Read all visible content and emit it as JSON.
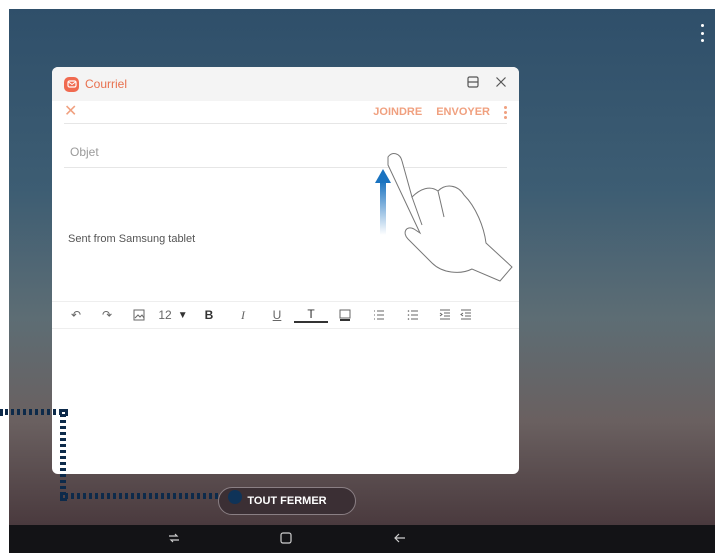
{
  "app": {
    "name": "Courriel"
  },
  "compose": {
    "join_label": "JOINDRE",
    "send_label": "ENVOYER",
    "subject_placeholder": "Objet",
    "body_text": "Sent from Samsung tablet"
  },
  "format_bar": {
    "font_size": "12"
  },
  "close_all_label": "TOUT FERMER",
  "icons": {
    "app": "email-icon",
    "split_view": "split-view-icon",
    "window_close": "close-icon",
    "overflow": "more-vertical-icon",
    "nav_recents": "recents-icon",
    "nav_home": "home-icon",
    "nav_back": "back-icon"
  },
  "colors": {
    "accent": "#f0a07f",
    "app_icon": "#f06a50",
    "pill": "#3b2f34",
    "callout": "#0f3358"
  }
}
